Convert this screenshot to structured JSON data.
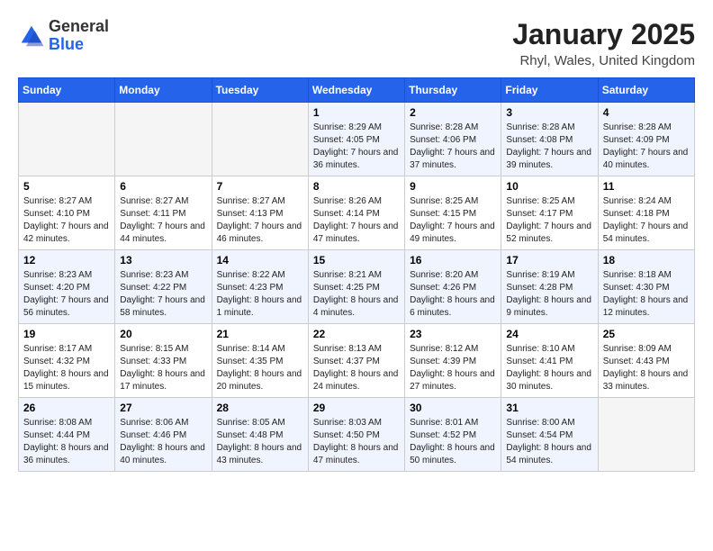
{
  "header": {
    "logo_general": "General",
    "logo_blue": "Blue",
    "title": "January 2025",
    "subtitle": "Rhyl, Wales, United Kingdom"
  },
  "days_of_week": [
    "Sunday",
    "Monday",
    "Tuesday",
    "Wednesday",
    "Thursday",
    "Friday",
    "Saturday"
  ],
  "weeks": [
    [
      {
        "day": "",
        "info": ""
      },
      {
        "day": "",
        "info": ""
      },
      {
        "day": "",
        "info": ""
      },
      {
        "day": "1",
        "info": "Sunrise: 8:29 AM\nSunset: 4:05 PM\nDaylight: 7 hours and 36 minutes."
      },
      {
        "day": "2",
        "info": "Sunrise: 8:28 AM\nSunset: 4:06 PM\nDaylight: 7 hours and 37 minutes."
      },
      {
        "day": "3",
        "info": "Sunrise: 8:28 AM\nSunset: 4:08 PM\nDaylight: 7 hours and 39 minutes."
      },
      {
        "day": "4",
        "info": "Sunrise: 8:28 AM\nSunset: 4:09 PM\nDaylight: 7 hours and 40 minutes."
      }
    ],
    [
      {
        "day": "5",
        "info": "Sunrise: 8:27 AM\nSunset: 4:10 PM\nDaylight: 7 hours and 42 minutes."
      },
      {
        "day": "6",
        "info": "Sunrise: 8:27 AM\nSunset: 4:11 PM\nDaylight: 7 hours and 44 minutes."
      },
      {
        "day": "7",
        "info": "Sunrise: 8:27 AM\nSunset: 4:13 PM\nDaylight: 7 hours and 46 minutes."
      },
      {
        "day": "8",
        "info": "Sunrise: 8:26 AM\nSunset: 4:14 PM\nDaylight: 7 hours and 47 minutes."
      },
      {
        "day": "9",
        "info": "Sunrise: 8:25 AM\nSunset: 4:15 PM\nDaylight: 7 hours and 49 minutes."
      },
      {
        "day": "10",
        "info": "Sunrise: 8:25 AM\nSunset: 4:17 PM\nDaylight: 7 hours and 52 minutes."
      },
      {
        "day": "11",
        "info": "Sunrise: 8:24 AM\nSunset: 4:18 PM\nDaylight: 7 hours and 54 minutes."
      }
    ],
    [
      {
        "day": "12",
        "info": "Sunrise: 8:23 AM\nSunset: 4:20 PM\nDaylight: 7 hours and 56 minutes."
      },
      {
        "day": "13",
        "info": "Sunrise: 8:23 AM\nSunset: 4:22 PM\nDaylight: 7 hours and 58 minutes."
      },
      {
        "day": "14",
        "info": "Sunrise: 8:22 AM\nSunset: 4:23 PM\nDaylight: 8 hours and 1 minute."
      },
      {
        "day": "15",
        "info": "Sunrise: 8:21 AM\nSunset: 4:25 PM\nDaylight: 8 hours and 4 minutes."
      },
      {
        "day": "16",
        "info": "Sunrise: 8:20 AM\nSunset: 4:26 PM\nDaylight: 8 hours and 6 minutes."
      },
      {
        "day": "17",
        "info": "Sunrise: 8:19 AM\nSunset: 4:28 PM\nDaylight: 8 hours and 9 minutes."
      },
      {
        "day": "18",
        "info": "Sunrise: 8:18 AM\nSunset: 4:30 PM\nDaylight: 8 hours and 12 minutes."
      }
    ],
    [
      {
        "day": "19",
        "info": "Sunrise: 8:17 AM\nSunset: 4:32 PM\nDaylight: 8 hours and 15 minutes."
      },
      {
        "day": "20",
        "info": "Sunrise: 8:15 AM\nSunset: 4:33 PM\nDaylight: 8 hours and 17 minutes."
      },
      {
        "day": "21",
        "info": "Sunrise: 8:14 AM\nSunset: 4:35 PM\nDaylight: 8 hours and 20 minutes."
      },
      {
        "day": "22",
        "info": "Sunrise: 8:13 AM\nSunset: 4:37 PM\nDaylight: 8 hours and 24 minutes."
      },
      {
        "day": "23",
        "info": "Sunrise: 8:12 AM\nSunset: 4:39 PM\nDaylight: 8 hours and 27 minutes."
      },
      {
        "day": "24",
        "info": "Sunrise: 8:10 AM\nSunset: 4:41 PM\nDaylight: 8 hours and 30 minutes."
      },
      {
        "day": "25",
        "info": "Sunrise: 8:09 AM\nSunset: 4:43 PM\nDaylight: 8 hours and 33 minutes."
      }
    ],
    [
      {
        "day": "26",
        "info": "Sunrise: 8:08 AM\nSunset: 4:44 PM\nDaylight: 8 hours and 36 minutes."
      },
      {
        "day": "27",
        "info": "Sunrise: 8:06 AM\nSunset: 4:46 PM\nDaylight: 8 hours and 40 minutes."
      },
      {
        "day": "28",
        "info": "Sunrise: 8:05 AM\nSunset: 4:48 PM\nDaylight: 8 hours and 43 minutes."
      },
      {
        "day": "29",
        "info": "Sunrise: 8:03 AM\nSunset: 4:50 PM\nDaylight: 8 hours and 47 minutes."
      },
      {
        "day": "30",
        "info": "Sunrise: 8:01 AM\nSunset: 4:52 PM\nDaylight: 8 hours and 50 minutes."
      },
      {
        "day": "31",
        "info": "Sunrise: 8:00 AM\nSunset: 4:54 PM\nDaylight: 8 hours and 54 minutes."
      },
      {
        "day": "",
        "info": ""
      }
    ]
  ]
}
